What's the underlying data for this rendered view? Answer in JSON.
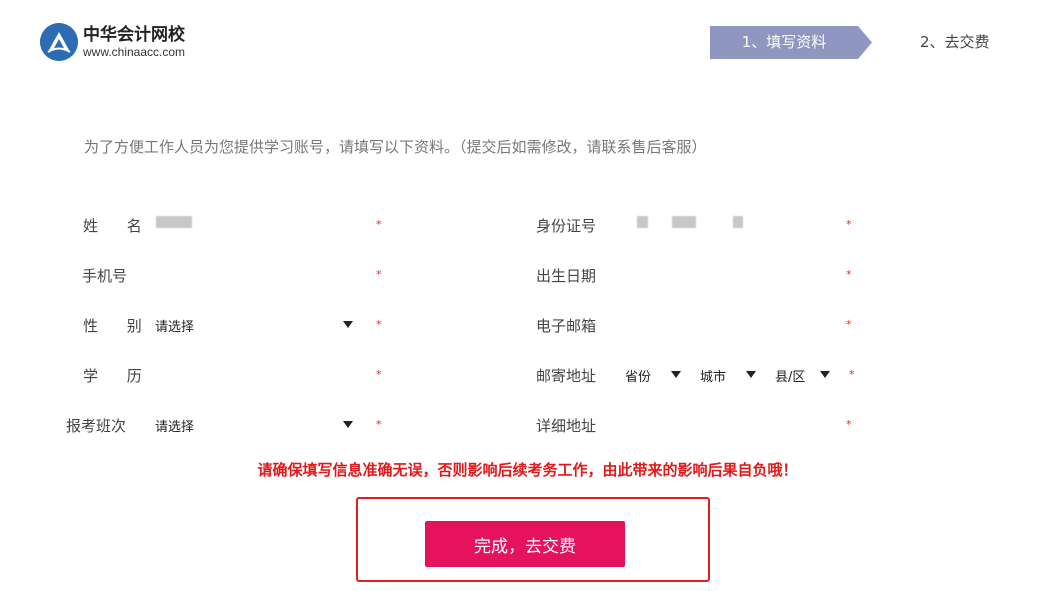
{
  "logo": {
    "name": "中华会计网校",
    "url": "www.chinaacc.com"
  },
  "steps": {
    "step1": "1、填写资料",
    "step2": "2、去交费",
    "active_color": "#8f96bf"
  },
  "intro": "为了方便工作人员为您提供学习账号，请填写以下资料。（提交后如需修改，请联系售后客服）",
  "form": {
    "required_mark": "*",
    "name_label": "姓  名",
    "phone_label": "手机号",
    "gender_label": "性  别",
    "gender_value": "请选择",
    "education_label": "学  历",
    "class_label": "报考班次",
    "class_value": "请选择",
    "id_label": "身份证号",
    "birth_label": "出生日期",
    "email_label": "电子邮箱",
    "mail_address_label": "邮寄地址",
    "province": "省份",
    "city": "城市",
    "district": "县/区",
    "detail_address_label": "详细地址"
  },
  "warning": "请确保填写信息准确无误，否则影响后续考务工作，由此带来的影响后果自负哦！",
  "submit_label": "完成，去交费",
  "colors": {
    "submit": "#e5125e",
    "warning": "#e01a1a",
    "required": "#d63030"
  }
}
